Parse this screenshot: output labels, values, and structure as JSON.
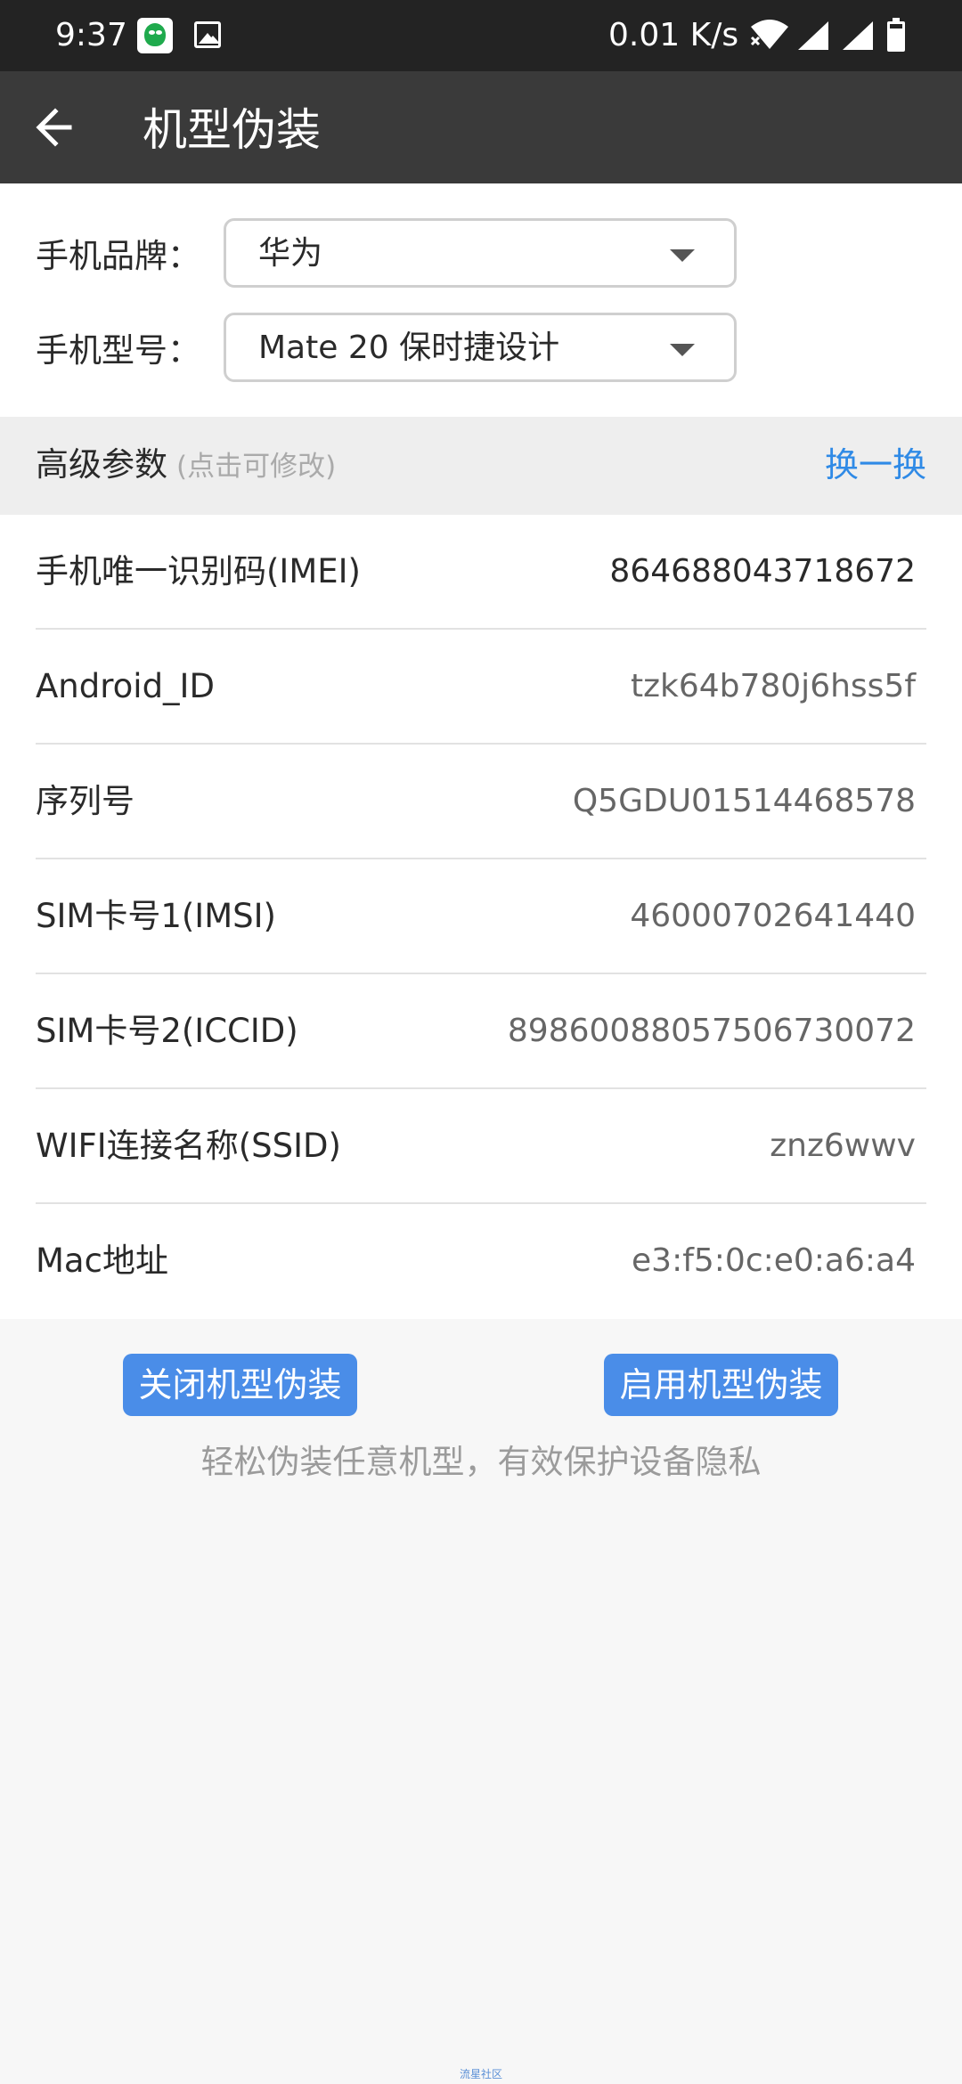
{
  "status_bar": {
    "time": "9:37",
    "net_speed": "0.01 K/s",
    "icons": [
      "app-notification-icon",
      "gallery-icon",
      "wifi-icon",
      "signal-icon",
      "signal-icon",
      "battery-icon"
    ]
  },
  "app_bar": {
    "title": "机型伪装",
    "back_icon": "arrow-left-icon"
  },
  "form": {
    "brand_label": "手机品牌：",
    "brand_value": "华为",
    "model_label": "手机型号：",
    "model_value": "Mate 20 保时捷设计"
  },
  "advanced": {
    "title": "高级参数",
    "hint": "(点击可修改)",
    "shuffle_label": "换一换",
    "rows": [
      {
        "label": "手机唯一识别码(IMEI)",
        "value": "864688043718672"
      },
      {
        "label": "Android_ID",
        "value": "tzk64b780j6hss5f"
      },
      {
        "label": "序列号",
        "value": "Q5GDU01514468578"
      },
      {
        "label": "SIM卡号1(IMSI)",
        "value": "46000702641440"
      },
      {
        "label": "SIM卡号2(ICCID)",
        "value": "89860088057506730072"
      },
      {
        "label": "WIFI连接名称(SSID)",
        "value": "znz6wwv"
      },
      {
        "label": "Mac地址",
        "value": "e3:f5:0c:e0:a6:a4"
      }
    ]
  },
  "actions": {
    "disable_label": "关闭机型伪装",
    "enable_label": "启用机型伪装",
    "tagline": "轻松伪装任意机型，有效保护设备隐私"
  },
  "watermark": "流星社区",
  "colors": {
    "accent": "#2f8ae6",
    "button": "#4a8de8",
    "app_bar": "#3a3a3a",
    "status_bar": "#232323"
  }
}
